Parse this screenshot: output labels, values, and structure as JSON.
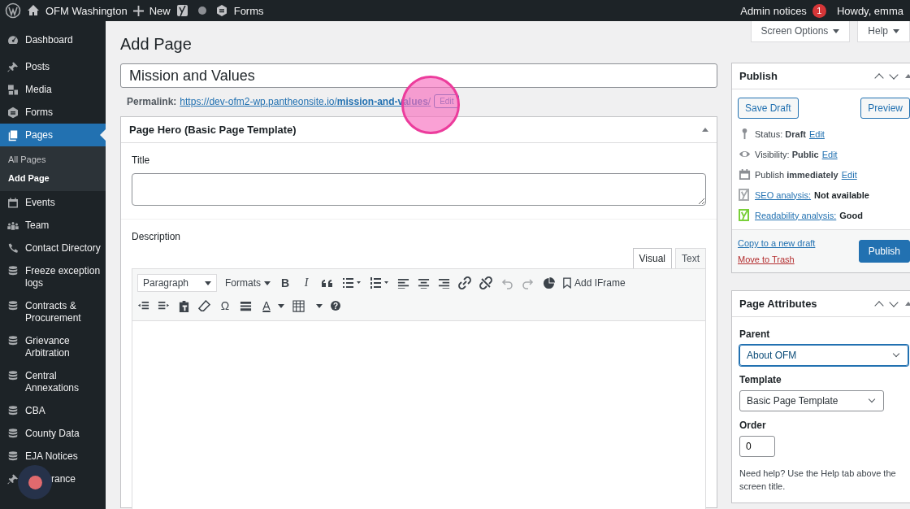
{
  "admin_bar": {
    "site": "OFM Washington",
    "new": "New",
    "forms": "Forms",
    "notices": "Admin notices",
    "notice_count": "1",
    "howdy": "Howdy, emma"
  },
  "sidebar": {
    "items": [
      {
        "label": "Dashboard",
        "selected": false
      },
      {
        "label": "Posts",
        "selected": false
      },
      {
        "label": "Media",
        "selected": false
      },
      {
        "label": "Forms",
        "selected": false
      },
      {
        "label": "Pages",
        "selected": true,
        "children": [
          {
            "label": "All Pages",
            "selected": false
          },
          {
            "label": "Add Page",
            "selected": true
          }
        ]
      },
      {
        "label": "Events",
        "selected": false
      },
      {
        "label": "Team",
        "selected": false
      },
      {
        "label": "Contact Directory",
        "selected": false
      },
      {
        "label": "Freeze exception logs",
        "selected": false
      },
      {
        "label": "Contracts & Procurement",
        "selected": false
      },
      {
        "label": "Grievance Arbitration",
        "selected": false
      },
      {
        "label": "Central Annexations",
        "selected": false
      },
      {
        "label": "CBA",
        "selected": false
      },
      {
        "label": "County Data",
        "selected": false
      },
      {
        "label": "EJA Notices",
        "selected": false
      },
      {
        "label": "rance",
        "selected": false
      }
    ]
  },
  "screen_tabs": [
    "Screen Options",
    "Help"
  ],
  "page": {
    "heading": "Add Page",
    "title_value": "Mission and Values",
    "permalink_label": "Permalink:",
    "permalink": "https://dev-ofm2-wp.pantheonsite.io/**mission-and-values**/",
    "permalink_edit": "Edit"
  },
  "hero_box": {
    "title": "Page Hero (Basic Page Template)",
    "title_label": "Title",
    "description_label": "Description",
    "editor_tabs": [
      {
        "label": "Visual",
        "selected": true
      },
      {
        "label": "Text",
        "selected": false
      }
    ],
    "toolbar": {
      "block_format": "Paragraph",
      "formats": "Formats",
      "bold": "B",
      "italic": "I",
      "add_iframe": "Add IFrame",
      "special_char": "Ω",
      "text_color": "A",
      "help": "?"
    }
  },
  "publish": {
    "title": "Publish",
    "save_draft": "Save Draft",
    "preview": "Preview",
    "rows": [
      {
        "text": "Status: **Draft**",
        "link": "Edit"
      },
      {
        "text": "Visibility: **Public**",
        "link": "Edit"
      },
      {
        "text": "Publish **immediately**",
        "link": "Edit"
      }
    ],
    "analyses": [
      {
        "link": "SEO analysis:",
        "value": "Not available",
        "color": "#a7aaad"
      },
      {
        "link": "Readability analysis:",
        "value": "Good",
        "color": "#7ad03a"
      }
    ],
    "copy": "Copy to a new draft",
    "trash": "Move to Trash",
    "publish_button": "Publish"
  },
  "attributes": {
    "title": "Page Attributes",
    "parent_label": "Parent",
    "parent": "About OFM",
    "template_label": "Template",
    "template": "Basic Page Template",
    "order_label": "Order",
    "order": "0",
    "help": "Need help? Use the Help tab above the screen title."
  }
}
